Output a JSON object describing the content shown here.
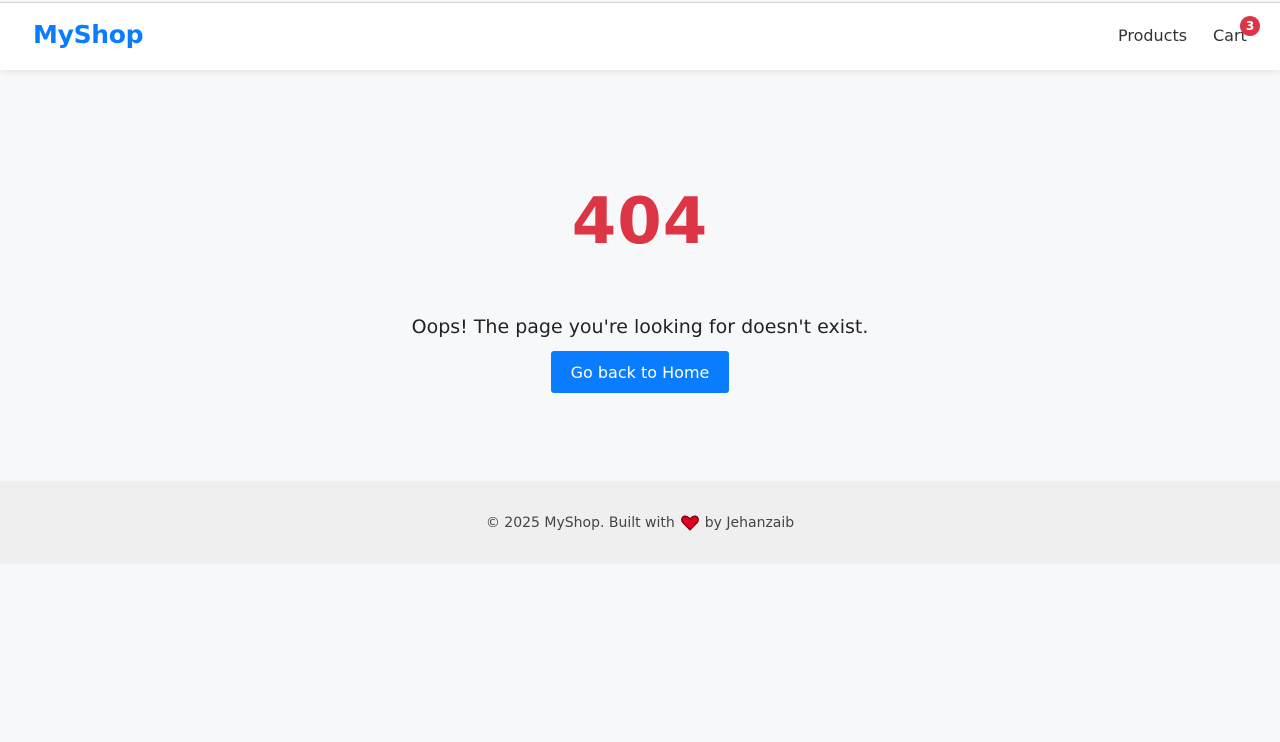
{
  "header": {
    "brand": "MyShop",
    "nav": {
      "products": "Products",
      "cart": "Cart",
      "cart_count": "3"
    }
  },
  "main": {
    "error_code": "404",
    "message": "Oops! The page you're looking for doesn't exist.",
    "button_label": "Go back to Home"
  },
  "footer": {
    "text_before": "© 2025 MyShop. Built with",
    "heart_icon": "heart-icon",
    "text_after": "by Jehanzaib"
  },
  "colors": {
    "brand": "#0a7cff",
    "error": "#dc3545",
    "badge": "#dc3545",
    "heart": "#e0001b"
  }
}
